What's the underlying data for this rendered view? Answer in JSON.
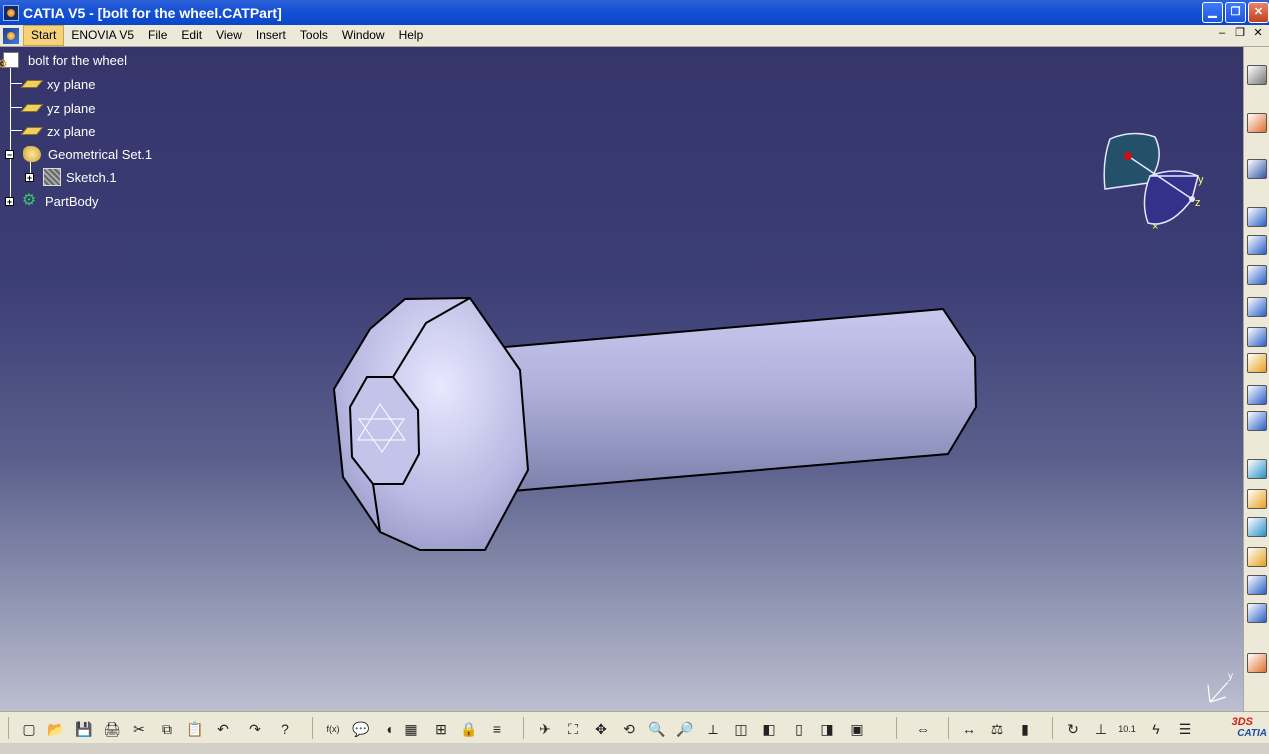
{
  "window": {
    "title": "CATIA V5 - [bolt for the wheel.CATPart]",
    "controls": [
      "minimize",
      "restore",
      "close"
    ]
  },
  "menu": {
    "items": [
      "Start",
      "ENOVIA V5",
      "File",
      "Edit",
      "View",
      "Insert",
      "Tools",
      "Window",
      "Help"
    ],
    "active": "Start"
  },
  "tree": {
    "root": "bolt for the wheel",
    "xy": "xy plane",
    "yz": "yz plane",
    "zx": "zx plane",
    "geoset": "Geometrical Set.1",
    "sketch": "Sketch.1",
    "body": "PartBody"
  },
  "compass": {
    "y_label": "y",
    "z_label": "z"
  },
  "axis": {
    "y_label": "y"
  },
  "logo": {
    "text": "CATIA"
  },
  "colors": {
    "part_face": "#b8b8e0",
    "background_top": "#35356a",
    "background_bottom": "#bcbfd0",
    "tree_text": "#ffffff"
  }
}
